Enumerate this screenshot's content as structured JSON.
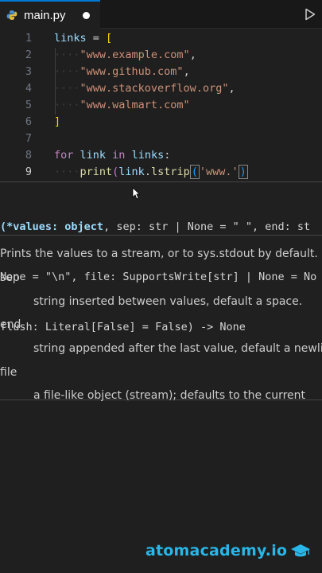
{
  "tab": {
    "filename": "main.py",
    "icon": "python-file-icon",
    "modified": true
  },
  "toolbar": {
    "run_icon": "run-triangle-icon"
  },
  "editor": {
    "line_numbers": [
      "1",
      "2",
      "3",
      "4",
      "5",
      "6",
      "7",
      "8",
      "9"
    ],
    "lines": {
      "l1_var": "links",
      "l1_eq": " = ",
      "l1_open": "[",
      "l2": "\"www.example.com\"",
      "l3": "\"www.github.com\"",
      "l4": "\"www.stackoverflow.org\"",
      "l5": "\"www.walmart.com\"",
      "comma": ",",
      "l6": "]",
      "l8_for": "for",
      "l8_link": " link ",
      "l8_in": "in",
      "l8_links": " links",
      "l8_colon": ":",
      "l9_fn": "print",
      "l9_open": "(",
      "l9_obj": "link",
      "l9_dot": ".",
      "l9_method": "lstrip",
      "l9_open2": "(",
      "l9_str": "'www.'",
      "l9_close": ")"
    }
  },
  "hover": {
    "sig_open": "(",
    "sig_values": "*values: object",
    "sig_rest1": ", sep: str | None = \" \", end: st",
    "sig_line2": "None = \"\\n\", file: SupportsWrite[str] | None = No",
    "sig_line3": "flush: Literal[False] = False) -> None",
    "doc_summary": "Prints the values to a stream, or to sys.stdout by default.",
    "param1_name": "sep",
    "param1_desc": "string inserted between values, default a space.",
    "param2_name": "end",
    "param2_desc": "string appended after the last value, default a newline",
    "param3_name": "file",
    "param3_desc": "a file-like object (stream); defaults to the current"
  },
  "brand": {
    "text": "atomacademy.io",
    "icon": "graduation-cap-icon",
    "color": "#29b6e8"
  },
  "colors": {
    "background": "#1f1f1f",
    "keyword": "#c586c0",
    "string": "#ce9178",
    "function": "#dcdcaa",
    "variable": "#9cdcfe"
  }
}
